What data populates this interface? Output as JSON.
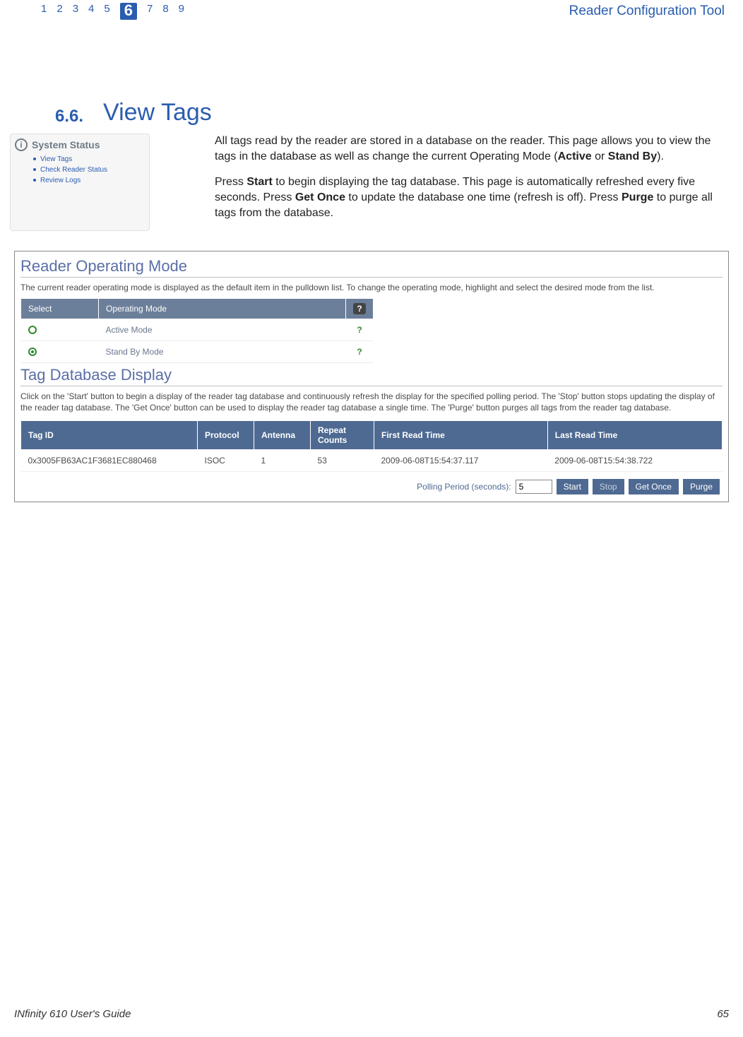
{
  "header": {
    "chapters": [
      "1",
      "2",
      "3",
      "4",
      "5",
      "6",
      "7",
      "8",
      "9"
    ],
    "current_chapter": "6",
    "title": "Reader Configuration Tool"
  },
  "section": {
    "number": "6.6.",
    "title": "View Tags"
  },
  "system_status": {
    "title": "System Status",
    "links": [
      "View Tags",
      "Check Reader Status",
      "Review Logs"
    ]
  },
  "intro": {
    "p1_a": "All tags read by the reader are stored in a database on the reader. This page allows you to view the tags in the database as well as change the current Operating Mode (",
    "p1_b": "Active",
    "p1_c": " or ",
    "p1_d": "Stand By",
    "p1_e": ").",
    "p2_a": "Press ",
    "p2_b": "Start",
    "p2_c": " to begin displaying the tag database. This page is automatically refreshed every five seconds. Press ",
    "p2_d": "Get Once",
    "p2_e": " to update the database one time (refresh is off). Press ",
    "p2_f": "Purge",
    "p2_g": " to purge all tags from the database."
  },
  "panel": {
    "operating_mode": {
      "heading": "Reader Operating Mode",
      "desc": "The current reader operating mode is displayed as the default item in the pulldown list. To change the operating mode, highlight and select the desired mode from the list.",
      "cols": {
        "select": "Select",
        "mode": "Operating Mode"
      },
      "help_symbol": "?",
      "rows": [
        {
          "label": "Active Mode",
          "selected": false
        },
        {
          "label": "Stand By Mode",
          "selected": true
        }
      ]
    },
    "tag_db": {
      "heading": "Tag Database Display",
      "desc": "Click on the 'Start' button to begin a display of the reader tag database and continuously refresh the display for the specified polling period. The 'Stop' button stops updating the display of the reader tag database. The 'Get Once' button can be used to display the reader tag database a single time. The 'Purge' button purges all tags from the reader tag database.",
      "cols": {
        "tag_id": "Tag ID",
        "protocol": "Protocol",
        "antenna": "Antenna",
        "repeat": "Repeat Counts",
        "first": "First Read Time",
        "last": "Last Read Time"
      },
      "rows": [
        {
          "tag_id": "0x3005FB63AC1F3681EC880468",
          "protocol": "ISOC",
          "antenna": "1",
          "repeat": "53",
          "first": "2009-06-08T15:54:37.117",
          "last": "2009-06-08T15:54:38.722"
        }
      ],
      "controls": {
        "polling_label": "Polling Period (seconds):",
        "polling_value": "5",
        "start": "Start",
        "stop": "Stop",
        "get_once": "Get Once",
        "purge": "Purge"
      }
    }
  },
  "footer": {
    "left_prefix": "IN",
    "left_italic": "finity",
    "left_rest": " 610 User's Guide",
    "page": "65"
  }
}
